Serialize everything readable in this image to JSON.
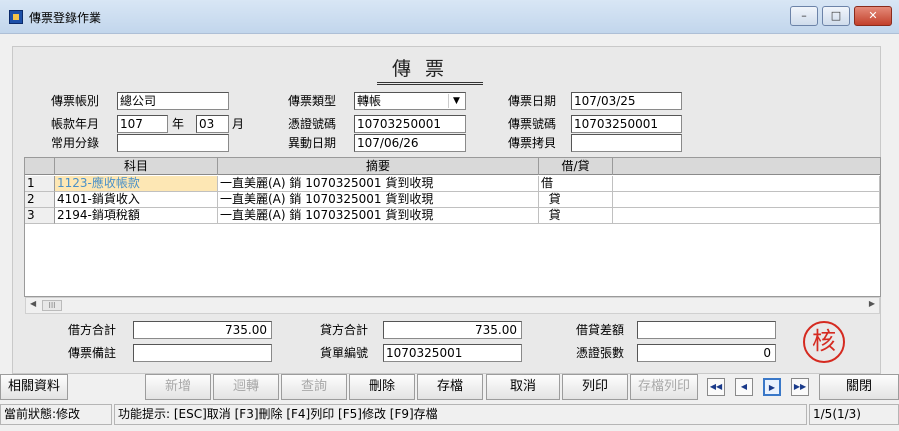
{
  "window": {
    "title": "傳票登錄作業",
    "min_glyph": "–",
    "max_glyph": "□",
    "close_glyph": "✕"
  },
  "doc_title": "傳票",
  "header": {
    "account_book_label": "傳票帳別",
    "account_book_value": "總公司",
    "period_label": "帳款年月",
    "period_year": "107",
    "year_unit": "年",
    "period_month": "03",
    "month_unit": "月",
    "common_entry_label": "常用分錄",
    "common_entry_value": "",
    "voucher_type_label": "傳票類型",
    "voucher_type_value": "轉帳",
    "evidence_no_label": "憑證號碼",
    "evidence_no_value": "10703250001",
    "change_date_label": "異動日期",
    "change_date_value": "107/06/26",
    "voucher_date_label": "傳票日期",
    "voucher_date_value": "107/03/25",
    "voucher_no_label": "傳票號碼",
    "voucher_no_value": "10703250001",
    "voucher_copy_label": "傳票拷貝",
    "voucher_copy_value": ""
  },
  "grid": {
    "columns": [
      "科目",
      "摘要",
      "借/貸"
    ],
    "rows": [
      {
        "num": "1",
        "subject": "1123-應收帳款",
        "summary": "一直美麗(A) 銷 1070325001  貨到收現",
        "dc": "借"
      },
      {
        "num": "2",
        "subject": "4101-銷貨收入",
        "summary": "一直美麗(A) 銷 1070325001  貨到收現",
        "dc": "  貸"
      },
      {
        "num": "3",
        "subject": "2194-銷項稅額",
        "summary": "一直美麗(A) 銷 1070325001  貨到收現",
        "dc": "  貸"
      }
    ],
    "scroll_thumb": "III"
  },
  "footer": {
    "debit_total_label": "借方合計",
    "debit_total_value": "735.00",
    "credit_total_label": "貸方合計",
    "credit_total_value": "735.00",
    "diff_label": "借貸差額",
    "diff_value": "",
    "remark_label": "傳票備註",
    "remark_value": "",
    "cargo_no_label": "貨單編號",
    "cargo_no_value": "1070325001",
    "evidence_count_label": "憑證張數",
    "evidence_count_value": "0",
    "stamp": "核"
  },
  "toolbar": {
    "related": "相關資料",
    "add": "新增",
    "transfer": "迴轉",
    "query": "查詢",
    "delete": "刪除",
    "save": "存檔",
    "cancel": "取消",
    "print": "列印",
    "save_print": "存檔列印",
    "close": "關閉",
    "nav_first": "◀◀",
    "nav_prev": "◀",
    "nav_next": "▶",
    "nav_last": "▶▶"
  },
  "status": {
    "state": "當前狀態:修改",
    "hint": "功能提示: [ESC]取消 [F3]刪除 [F4]列印 [F5]修改 [F9]存檔",
    "record": "1/5(1/3)"
  }
}
